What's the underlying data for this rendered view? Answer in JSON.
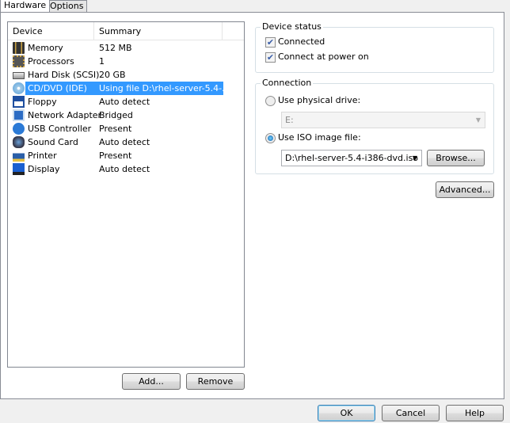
{
  "tabs": [
    {
      "label": "Hardware"
    },
    {
      "label": "Options"
    }
  ],
  "device_list": {
    "columns": [
      "Device",
      "Summary"
    ],
    "rows": [
      {
        "name": "Memory",
        "summary": "512 MB",
        "icon": "memory-icon"
      },
      {
        "name": "Processors",
        "summary": "1",
        "icon": "processor-icon"
      },
      {
        "name": "Hard Disk (SCSI)",
        "summary": "20 GB",
        "icon": "hard-disk-icon"
      },
      {
        "name": "CD/DVD (IDE)",
        "summary": "Using file D:\\rhel-server-5.4-...",
        "icon": "cd-dvd-icon",
        "selected": true
      },
      {
        "name": "Floppy",
        "summary": "Auto detect",
        "icon": "floppy-icon"
      },
      {
        "name": "Network Adapter",
        "summary": "Bridged",
        "icon": "network-adapter-icon"
      },
      {
        "name": "USB Controller",
        "summary": "Present",
        "icon": "usb-icon"
      },
      {
        "name": "Sound Card",
        "summary": "Auto detect",
        "icon": "sound-card-icon"
      },
      {
        "name": "Printer",
        "summary": "Present",
        "icon": "printer-icon"
      },
      {
        "name": "Display",
        "summary": "Auto detect",
        "icon": "display-icon"
      }
    ],
    "add_label": "Add...",
    "remove_label": "Remove"
  },
  "device_status": {
    "title": "Device status",
    "connected": "Connected",
    "connect_power_on": "Connect at power on"
  },
  "connection": {
    "title": "Connection",
    "physical": "Use physical drive:",
    "physical_value": "E:",
    "iso": "Use ISO image file:",
    "iso_value": "D:\\rhel-server-5.4-i386-dvd.iso",
    "browse": "Browse..."
  },
  "advanced": "Advanced...",
  "footer": {
    "ok": "OK",
    "cancel": "Cancel",
    "help": "Help"
  },
  "colors": {
    "selection": "#3399ff"
  }
}
